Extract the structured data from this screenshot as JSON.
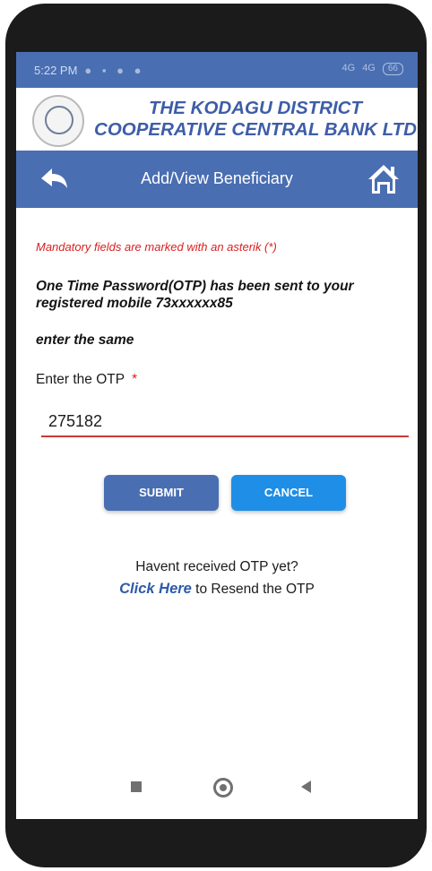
{
  "statusbar": {
    "time": "5:22 PM",
    "network_1": "4G",
    "network_2": "4G",
    "battery": "66"
  },
  "bank": {
    "name_line1": "THE KODAGU DISTRICT",
    "name_line2": "COOPERATIVE CENTRAL BANK LTD"
  },
  "navbar": {
    "title": "Add/View Beneficiary",
    "back_icon": "back-arrow-icon",
    "home_icon": "home-icon"
  },
  "form": {
    "mandatory_note": "Mandatory fields are marked with an asterik (*)",
    "otp_message": "One Time Password(OTP) has been sent to your registered mobile 73xxxxxx85",
    "enter_same": "enter the same",
    "otp_label": "Enter the OTP",
    "required_mark": "*",
    "otp_value": "275182"
  },
  "buttons": {
    "submit": "SUBMIT",
    "cancel": "CANCEL"
  },
  "resend": {
    "question": "Havent received OTP yet?",
    "link": "Click Here",
    "suffix": " to Resend the OTP"
  },
  "colors": {
    "primary": "#4a6eb2",
    "accent": "#1f8ee6",
    "error": "#d71f1f"
  }
}
